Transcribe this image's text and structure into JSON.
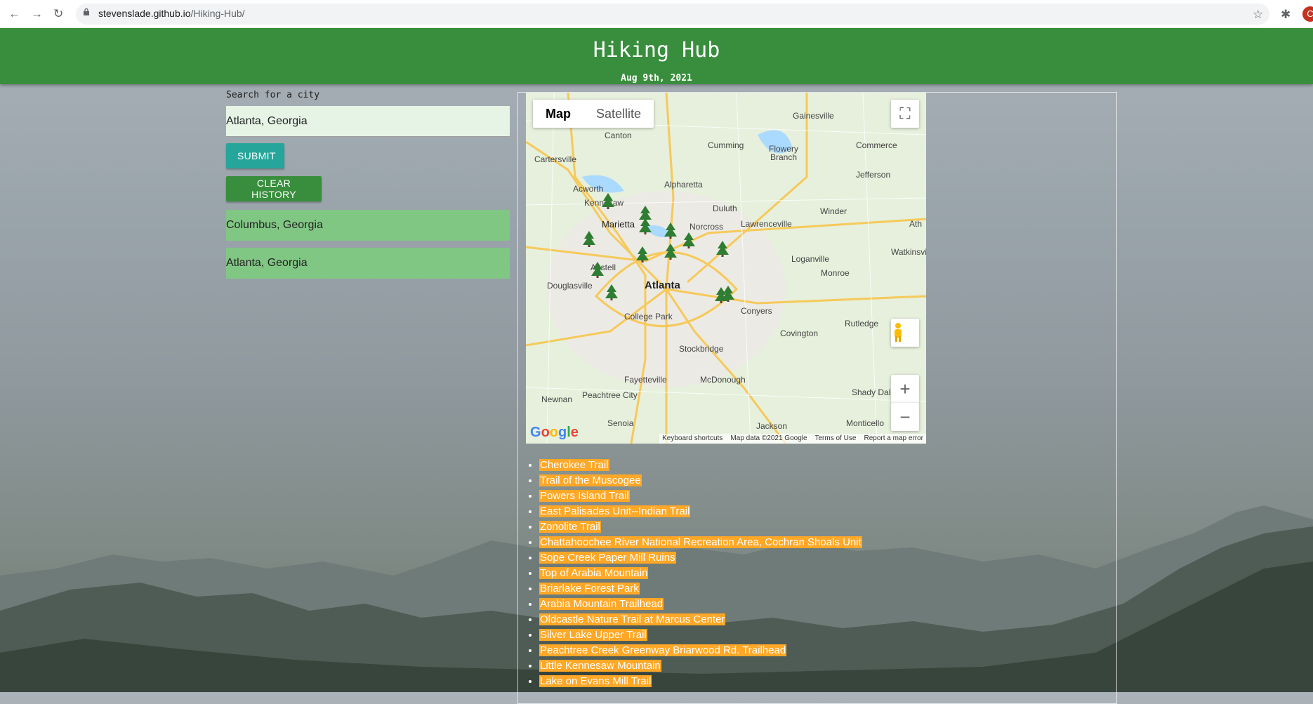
{
  "browser": {
    "url_host": "stevenslade.github.io",
    "url_path": "/Hiking-Hub/",
    "profile_initial": "C"
  },
  "header": {
    "title": "Hiking Hub",
    "date": "Aug 9th, 2021"
  },
  "search": {
    "label": "Search for a city",
    "value": "Atlanta, Georgia",
    "submit_label": "SUBMIT",
    "clear_label": "CLEAR HISTORY"
  },
  "history": [
    "Columbus, Georgia",
    "Atlanta, Georgia"
  ],
  "map": {
    "type_map": "Map",
    "type_satellite": "Satellite",
    "center_label": "Atlanta",
    "places": [
      "Gainesville",
      "Canton",
      "Cumming",
      "Flowery Branch",
      "Cartersville",
      "Commerce",
      "Jefferson",
      "Alpharetta",
      "Acworth",
      "Kennesaw",
      "Duluth",
      "Winder",
      "Marietta",
      "Norcross",
      "Lawrenceville",
      "Ath",
      "Austell",
      "Watkinsvi",
      "Loganville",
      "Monroe",
      "Douglasville",
      "Conyers",
      "College Park",
      "Rutledge",
      "Covington",
      "Stockbridge",
      "Fayetteville",
      "McDonough",
      "Peachtree City",
      "Newnan",
      "Shady Dale",
      "Senoia",
      "Jackson",
      "Monticello"
    ],
    "footer": {
      "shortcuts": "Keyboard shortcuts",
      "data": "Map data ©2021 Google",
      "terms": "Terms of Use",
      "report": "Report a map error"
    },
    "logo": "Google",
    "zoom_in": "+",
    "zoom_out": "−"
  },
  "trails": [
    "Cherokee Trail",
    "Trail of the Muscogee",
    "Powers Island Trail",
    "East Palisades Unit--Indian Trail",
    "Zonolite Trail",
    "Chattahoochee River National Recreation Area, Cochran Shoals Unit",
    "Sope Creek Paper Mill Ruins",
    "Top of Arabia Mountain",
    "Briarlake Forest Park",
    "Arabia Mountain Trailhead",
    "Oldcastle Nature Trail at Marcus Center",
    "Silver Lake Upper Trail",
    "Peachtree Creek Greenway Briarwood Rd. Trailhead",
    "Little Kennesaw Mountain",
    "Lake on Evans Mill Trail"
  ],
  "colors": {
    "header": "#388e3c",
    "submit": "#26a69a",
    "history_bg": "#81c784",
    "trail_highlight": "#ffa726"
  }
}
